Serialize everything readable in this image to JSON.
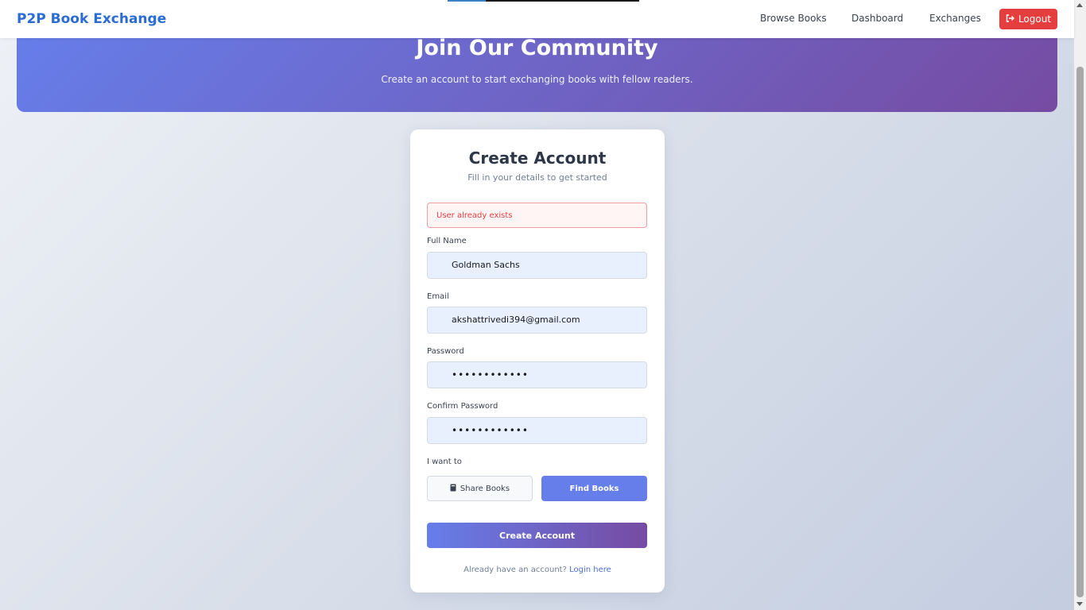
{
  "nav": {
    "brand": "P2P Book Exchange",
    "links": [
      "Browse Books",
      "Dashboard",
      "Exchanges"
    ],
    "logout_label": "Logout",
    "logout_icon": "sign-out-icon"
  },
  "page_progress": 0.2,
  "hero": {
    "title": "Join Our Community",
    "subtitle": "Create an account to start exchanging books with fellow readers."
  },
  "form": {
    "title": "Create Account",
    "subtitle": "Fill in your details to get started",
    "error": "User already exists",
    "full_name": {
      "label": "Full Name",
      "value": "Goldman Sachs"
    },
    "email": {
      "label": "Email",
      "value": "akshattrivedi394@gmail.com"
    },
    "password": {
      "label": "Password",
      "value": "••••••••••••"
    },
    "confirm_password": {
      "label": "Confirm Password",
      "value": "••••••••••••"
    },
    "role_label": "I want to",
    "role_options": [
      {
        "label": "Share Books",
        "icon": "book-icon",
        "selected": false
      },
      {
        "label": "Find Books",
        "selected": true
      }
    ],
    "submit_label": "Create Account",
    "footer_text": "Already have an account?",
    "footer_link": "Login here"
  },
  "colors": {
    "brand": "#2b6cd4",
    "hero_gradient_start": "#667eea",
    "hero_gradient_end": "#764ba2",
    "logout": "#e53e3e",
    "error": "#e53e3e"
  }
}
